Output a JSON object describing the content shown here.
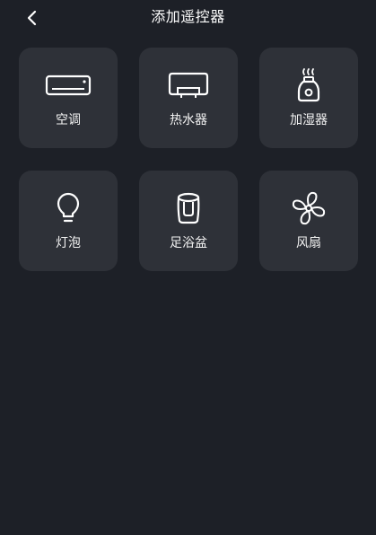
{
  "header": {
    "title": "添加遥控器",
    "back_icon": "chevron-left-icon"
  },
  "devices": [
    {
      "label": "空调",
      "icon": "air-conditioner-icon"
    },
    {
      "label": "热水器",
      "icon": "water-heater-icon"
    },
    {
      "label": "加湿器",
      "icon": "humidifier-icon"
    },
    {
      "label": "灯泡",
      "icon": "light-bulb-icon"
    },
    {
      "label": "足浴盆",
      "icon": "foot-bath-icon"
    },
    {
      "label": "风扇",
      "icon": "fan-icon"
    }
  ],
  "colors": {
    "background": "#1d2027",
    "card": "#2e3138",
    "text": "#ffffff"
  }
}
